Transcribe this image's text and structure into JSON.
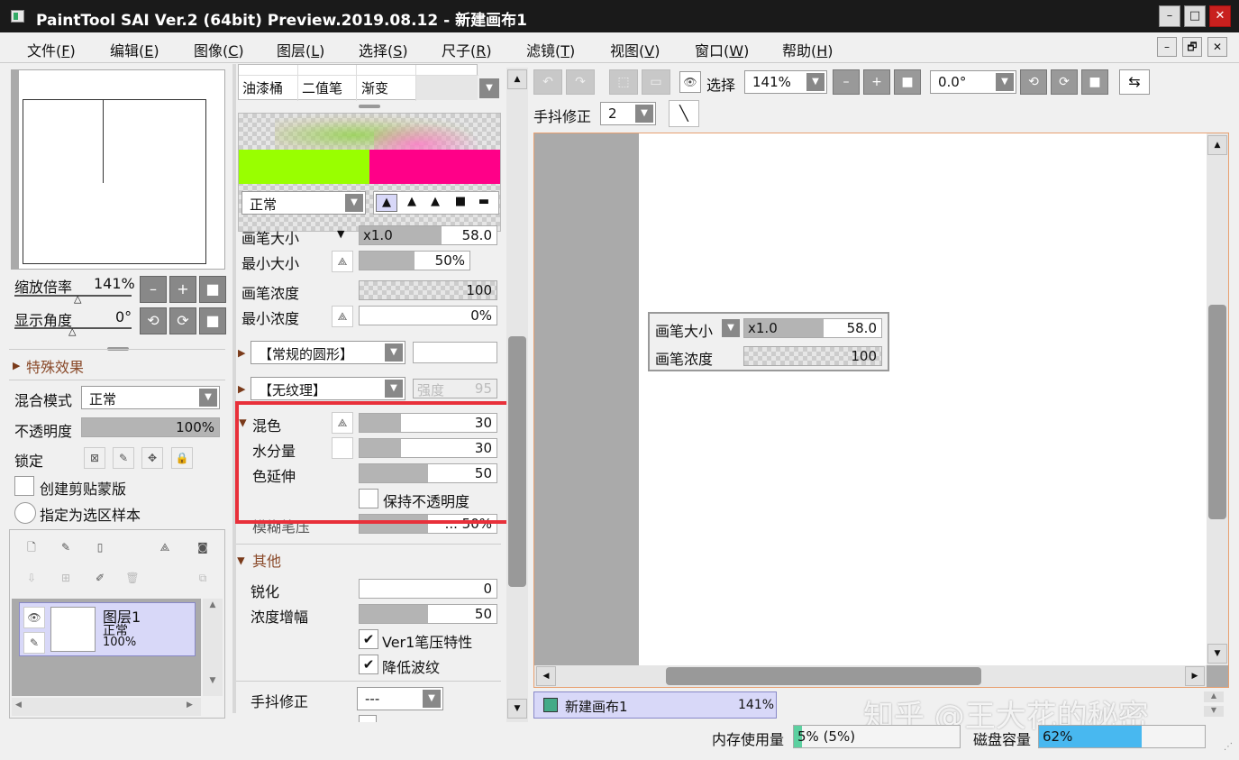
{
  "window": {
    "title": "PaintTool SAI Ver.2 (64bit) Preview.2019.08.12 - 新建画布1",
    "min": "–",
    "max": "□",
    "close": "✕"
  },
  "menu": {
    "items": [
      {
        "label": "文件(",
        "key": "F",
        "end": ")"
      },
      {
        "label": "编辑(",
        "key": "E",
        "end": ")"
      },
      {
        "label": "图像(",
        "key": "C",
        "end": ")"
      },
      {
        "label": "图层(",
        "key": "L",
        "end": ")"
      },
      {
        "label": "选择(",
        "key": "S",
        "end": ")"
      },
      {
        "label": "尺子(",
        "key": "R",
        "end": ")"
      },
      {
        "label": "滤镜(",
        "key": "T",
        "end": ")"
      },
      {
        "label": "视图(",
        "key": "V",
        "end": ")"
      },
      {
        "label": "窗口(",
        "key": "W",
        "end": ")"
      },
      {
        "label": "帮助(",
        "key": "H",
        "end": ")"
      }
    ],
    "mdi": [
      "–",
      "🗗",
      "✕"
    ]
  },
  "navigator": {
    "zoom_label": "缩放倍率",
    "zoom_value": "141%",
    "angle_label": "显示角度",
    "angle_value": "0°",
    "zoom_btns": [
      "–",
      "+",
      "■"
    ],
    "angle_btns": [
      "⟲",
      "⟳",
      "■"
    ]
  },
  "effects": {
    "header": "特殊效果"
  },
  "layer_props": {
    "blend_label": "混合模式",
    "blend_value": "正常",
    "opacity_label": "不透明度",
    "opacity_value": "100%",
    "opacity": 1.0,
    "lock_label": "锁定",
    "clip_label": "创建剪贴蒙版",
    "sample_label": "指定为选区样本"
  },
  "layers": [
    {
      "name": "图层1",
      "mode": "正常",
      "opacity": "100%"
    }
  ],
  "tools": {
    "row": [
      "油漆桶",
      "二值笔",
      "渐变"
    ]
  },
  "colors": {
    "left": "#99ff00",
    "right": "#ff0088"
  },
  "brush": {
    "mode": "正常",
    "size_label": "画笔大小",
    "size_mult": "x1.0",
    "size_value": "58.0",
    "size_fill": 0.6,
    "min_size_label": "最小大小",
    "min_size_value": "50%",
    "min_size_fill": 0.5,
    "density_label": "画笔浓度",
    "density_value": "100",
    "min_density_label": "最小浓度",
    "min_density_value": "0%",
    "shape": "【常规的圆形】",
    "texture": "【无纹理】",
    "strength_label": "强度",
    "strength_value": "95",
    "blend_label": "混色",
    "blend_value": "30",
    "blend_fill": 0.3,
    "water_label": "水分量",
    "water_value": "30",
    "water_fill": 0.3,
    "stretch_label": "色延伸",
    "stretch_value": "50",
    "stretch_fill": 0.5,
    "keep_opacity_label": "保持不透明度",
    "blur_label": "模糊笔压",
    "blur_value": "... 50%",
    "other_header": "其他",
    "sharpen_label": "锐化",
    "sharpen_value": "0",
    "gain_label": "浓度增幅",
    "gain_value": "50",
    "gain_fill": 0.5,
    "ver1_label": "Ver1笔压特性",
    "wave_label": "降低波纹",
    "stab_label": "手抖修正",
    "stab_value": "---"
  },
  "toolbar": {
    "select_label": "选择",
    "zoom": "141%",
    "angle": "0.0°",
    "stab_label": "手抖修正",
    "stab_value": "2"
  },
  "canvas_popup": {
    "size_label": "画笔大小",
    "size_mult": "x1.0",
    "size_value": "58.0",
    "density_label": "画笔浓度",
    "density_value": "100"
  },
  "doc_tab": {
    "name": "新建画布1",
    "zoom": "141%"
  },
  "status": {
    "mem_label": "内存使用量",
    "mem_value": "5% (5%)",
    "mem_fill": 0.05,
    "disk_label": "磁盘容量",
    "disk_value": "62%",
    "disk_fill": 0.62
  },
  "watermark": "知乎 @王大花的秘密"
}
